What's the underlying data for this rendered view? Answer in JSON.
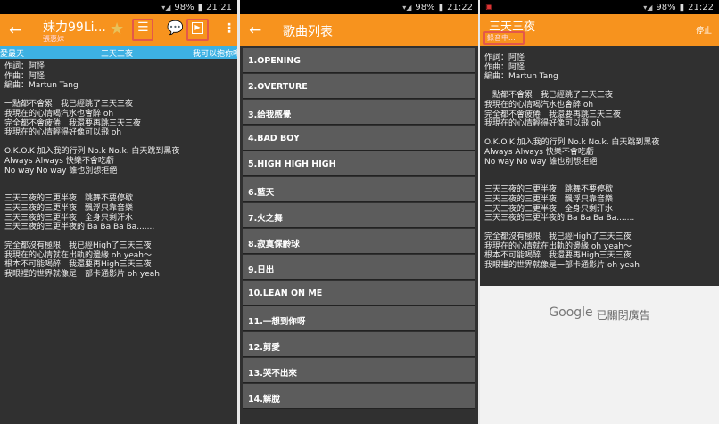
{
  "status": {
    "p1": {
      "battery": "98%",
      "time": "21:21"
    },
    "p2": {
      "battery": "98%",
      "time": "21:22"
    },
    "p3": {
      "battery": "98%",
      "time": "21:22"
    }
  },
  "player": {
    "title": "妹力99Li...",
    "artist": "張惠妹",
    "prev_song": "愛最天",
    "current_song": "三天三夜",
    "next_song": "我可以抱你嗎"
  },
  "lyrics": [
    "作詞：阿怪",
    "作曲：阿怪",
    "編曲：Martun Tang",
    "",
    "一點都不會累　我已經跳了三天三夜",
    "我現在的心情喝汽水也會醉 oh",
    "完全都不會疲倦　我還要再跳三天三夜",
    "我現在的心情輕得好像可以飛 oh",
    "",
    "O.K.O.K 加入我的行列 No.k No.k. 白天跳到黑夜",
    "Always Always 快樂不會吃虧",
    "No way No way 誰也別想拒絕",
    "",
    "",
    "三天三夜的三更半夜　跳舞不要停歇",
    "三天三夜的三更半夜　飄浮只靠音樂",
    "三天三夜的三更半夜　全身只剩汗水",
    "三天三夜的三更半夜的 Ba Ba Ba Ba.......",
    "",
    "完全都沒有極限　我已經High了三天三夜",
    "我現在的心情就在出軌的邊緣 oh yeah～",
    "根本不可能喝醉　我還要再High三天三夜",
    "我眼裡的世界就像是一部卡通影片 oh yeah"
  ],
  "song_list": {
    "title": "歌曲列表",
    "items": [
      "1.OPENING",
      "2.OVERTURE",
      "3.給我感覺",
      "4.BAD BOY",
      "5.HIGH HIGH HIGH",
      "6.藍天",
      "7.火之舞",
      "8.寂寞保齡球",
      "9.日出",
      "10.LEAN ON ME",
      "11.一想到你呀",
      "12.剪愛",
      "13.哭不出來",
      "14.解脫"
    ]
  },
  "recording": {
    "title": "三天三夜",
    "status": "錄音中...",
    "stop_label": "停止"
  },
  "ad": {
    "brand": "Google",
    "text": "已關閉廣告"
  },
  "colors": {
    "accent": "#f7931e",
    "lyric_bar": "#3db1e3",
    "highlight": "#e4584a"
  }
}
